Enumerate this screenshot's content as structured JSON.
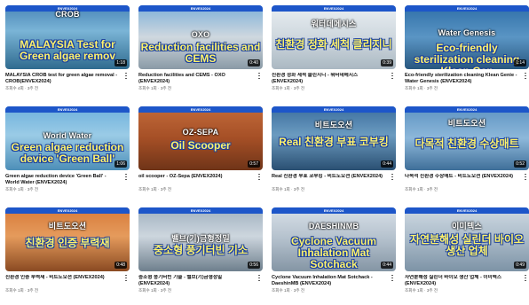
{
  "videos": [
    {
      "tag": "CROB",
      "headline": "MALAYSIA Test for Green algae remov",
      "duration": "1:18",
      "title": "MALAYSIA CROB test for green algae removal - CROB(ENVEX2024)",
      "meta": "조회수 4회 · 3주 전",
      "bg": "linear-gradient(180deg,#4a86b8 0%,#7ab4d6 40%,#2f6b8f 100%)"
    },
    {
      "tag": "OXO",
      "headline": "Reduction facilities and CEMS",
      "duration": "0:40",
      "title": "Reduction facilities and CEMS - OXO (ENVEX2024)",
      "meta": "조회수 1회 · 3주 전",
      "bg": "linear-gradient(180deg,#7fb0d8 0%,#cfd8df 50%,#8a9aa6 100%)"
    },
    {
      "tag": "워터데메시스",
      "headline": "친환경 정화 세척 클리지니",
      "duration": "0:39",
      "title": "친환경 정화 세척 클린지니 - 워터데메시스 (ENVEX2024)",
      "meta": "조회수 1회 · 3주 전",
      "bg": "linear-gradient(180deg,#e9eef2 0%,#c9d3da 60%,#aab8c2 100%)"
    },
    {
      "tag": "Water Genesis",
      "headline": "Eco-friendly sterilization cleaning Klean Gen",
      "duration": "1:14",
      "title": "Eco-friendly sterilization cleaning Klean Genie - Water Genesis (ENVEX2024)",
      "meta": "조회수 1회 · 3주 전",
      "bg": "linear-gradient(180deg,#2f6fa8 0%,#5a95c4 50%,#28577f 100%)"
    },
    {
      "tag": "World Water",
      "headline": "Green algae reduction device 'Green Ball'",
      "duration": "1:06",
      "title": "Green algae reduction device 'Green Ball' - World Water (ENVEX2024)",
      "meta": "조회수 1회 · 3주 전",
      "bg": "linear-gradient(180deg,#6db0dc 0%,#9acbe6 45%,#4d8fb8 100%)"
    },
    {
      "tag": "OZ-SEPA",
      "headline": "Oil Scooper",
      "duration": "0:57",
      "title": "oil scooper - OZ-Sepa (ENVEX2024)",
      "meta": "조회수 1회 · 3주 전",
      "bg": "linear-gradient(180deg,#c26a3a 0%,#a54f26 50%,#6f3418 100%)"
    },
    {
      "tag": "비트도오션",
      "headline": "Real 친환경 부표 코부킹",
      "duration": "0:44",
      "title": "Real 친환경 부표 코부킹 - 비트도오션 (ENVEX2024)",
      "meta": "조회수 1회 · 3주 전",
      "bg": "linear-gradient(180deg,#3b6e9e 0%,#6b9bc0 45%,#2a4f72 100%)"
    },
    {
      "tag": "비트도오션",
      "headline": "다목적 친환경 수상매트",
      "duration": "0:52",
      "title": "다목적 친환경 수상매트 - 비트도오션 (ENVEX2024)",
      "meta": "조회수 1회 · 3주 전",
      "bg": "linear-gradient(180deg,#5d92c2 0%,#8db8da 50%,#3f6f99 100%)"
    },
    {
      "tag": "비트도오션",
      "headline": "친환경 인증 부력재",
      "duration": "0:48",
      "title": "친환경 인증 부력재 - 비트도오션 (ENVEX2024)",
      "meta": "조회수 1회 · 3주 전",
      "bg": "linear-gradient(180deg,#d77a3a 0%,#e59b5c 45%,#8a4a22 100%)"
    },
    {
      "tag": "밸브(기)금형정밀",
      "headline": "중소형 풍기터빈 기소",
      "duration": "0:56",
      "title": "중소형 풍기터빈 기술 - 밸브(기)금형정밀 (ENVEX2024)",
      "meta": "조회수 1회 · 3주 전",
      "bg": "linear-gradient(180deg,#9fb0bf 0%,#cdd6de 45%,#6e7f8d 100%)"
    },
    {
      "tag": "DAESHINMB",
      "headline": "Cyclone Vacuum Inhalation Mat Sotchack",
      "duration": "0:44",
      "title": "Cyclone Vacuum Inhalation Mat Sotchack - DaeshinMB (ENVEX2024)",
      "meta": "조회수 1회 · 3주 전",
      "bg": "linear-gradient(180deg,#d8e0e8 0%,#b3c0cc 50%,#8495a4 100%)"
    },
    {
      "tag": "이미텍스",
      "headline": "자연분해성 실린더 바이오 생산 업체",
      "duration": "0:49",
      "title": "자연분해성 실린더 바이오 생산 업체 - 이미텍스 (ENVEX2024)",
      "meta": "조회수 1회 · 3주 전",
      "bg": "linear-gradient(180deg,#cfd9e2 0%,#a9bac8 50%,#7d93a6 100%)"
    }
  ],
  "band_label": "ENVEX2024",
  "accent": "#1d56c9",
  "headline_color": "#fff36b"
}
